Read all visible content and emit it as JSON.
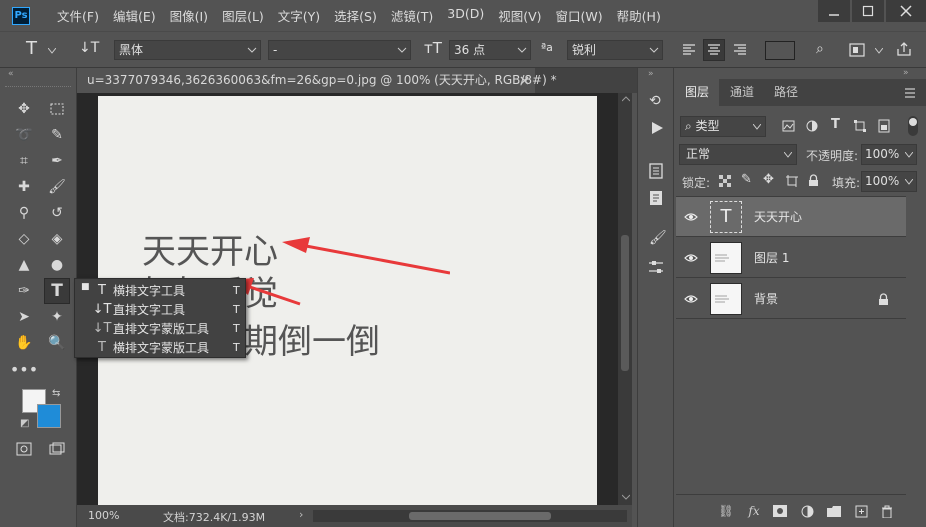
{
  "app": {
    "logo": "Ps"
  },
  "menu": [
    "文件(F)",
    "编辑(E)",
    "图像(I)",
    "图层(L)",
    "文字(Y)",
    "选择(S)",
    "滤镜(T)",
    "3D(D)",
    "视图(V)",
    "窗口(W)",
    "帮助(H)"
  ],
  "options": {
    "font_family": "黑体",
    "font_style": "-",
    "font_size": "36 点",
    "antialias_icon": "ªa",
    "antialias": "锐利"
  },
  "document": {
    "tab_title": "u=3377079346,3626360063&fm=26&gp=0.jpg @ 100% (天天开心, RGB/8#) *",
    "zoom": "100%",
    "doc_info": "文档:732.4K/1.93M",
    "paper_text": [
      "天天开心",
      "好好睡觉",
      "垃圾定期倒一倒"
    ]
  },
  "flyout": {
    "items": [
      {
        "icon": "T",
        "label": "横排文字工具",
        "shortcut": "T",
        "active": true
      },
      {
        "icon": "↓T",
        "label": "直排文字工具",
        "shortcut": "T",
        "active": false
      },
      {
        "icon": "↓T",
        "label": "直排文字蒙版工具",
        "shortcut": "T",
        "active": false
      },
      {
        "icon": "T",
        "label": "横排文字蒙版工具",
        "shortcut": "T",
        "active": false
      }
    ]
  },
  "layers_panel": {
    "tabs": [
      "图层",
      "通道",
      "路径"
    ],
    "filter_label": "类型",
    "blend_mode": "正常",
    "opacity_label": "不透明度:",
    "opacity": "100%",
    "lock_label": "锁定:",
    "fill_label": "填充:",
    "fill": "100%",
    "layers": [
      {
        "name": "天天开心",
        "type": "text",
        "selected": true
      },
      {
        "name": "图层 1",
        "type": "image",
        "selected": false
      },
      {
        "name": "背景",
        "type": "background",
        "selected": false,
        "locked": true
      }
    ],
    "bottom_icons": [
      "link-icon",
      "fx-icon",
      "mask-icon",
      "adjustment-icon",
      "group-icon",
      "new-layer-icon",
      "trash-icon"
    ]
  },
  "colors": {
    "accent_blue": "#1f8cd8",
    "arrow_red": "#e8393a",
    "panel_bg": "#535353",
    "dark_bg": "#282828",
    "paper_bg": "#efefec"
  }
}
